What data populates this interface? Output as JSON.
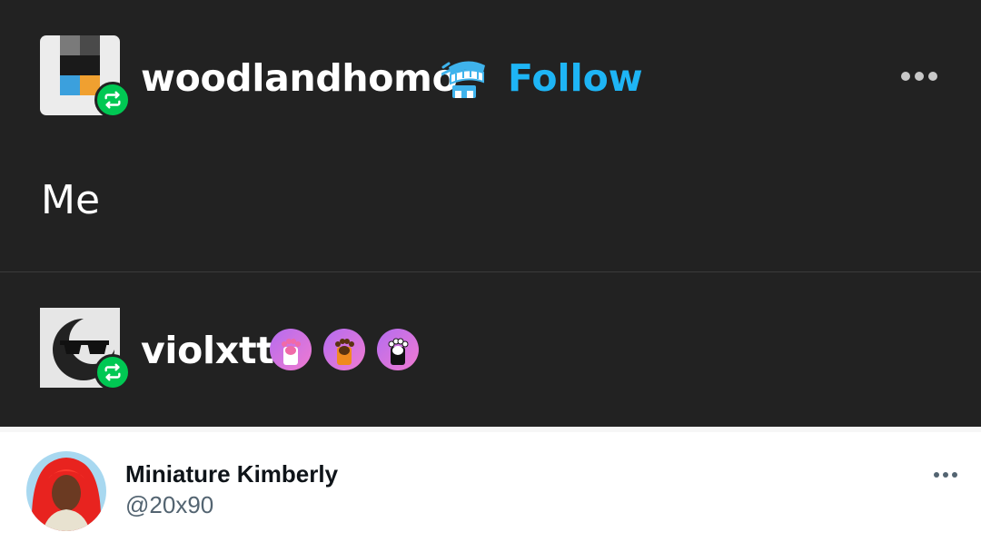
{
  "post1": {
    "username": "woodlandhomo",
    "follow_label": "Follow",
    "body_text": "Me",
    "badge_icon": "wind-up-teeth-icon",
    "accent_color": "#1eb5f5"
  },
  "post2": {
    "username": "violxtt",
    "badges": [
      "pink-paw-icon",
      "orange-paw-icon",
      "black-paw-icon"
    ]
  },
  "tweet": {
    "display_name": "Miniature Kimberly",
    "handle": "@20x90"
  },
  "colors": {
    "reblog_badge": "#00c853",
    "dark_background": "#222222"
  }
}
